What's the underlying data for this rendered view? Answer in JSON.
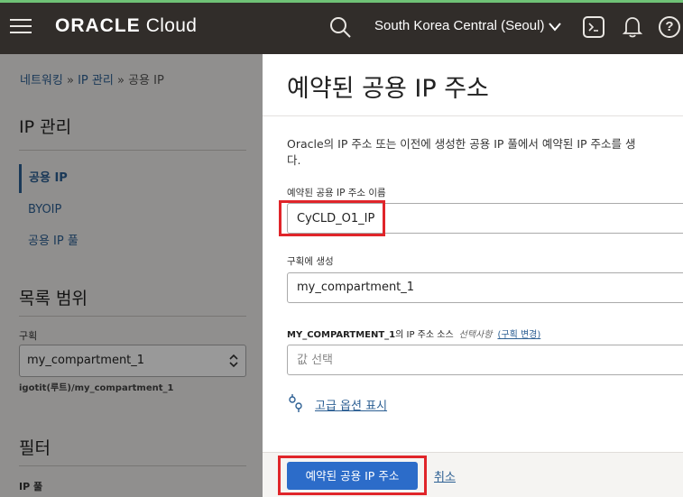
{
  "header": {
    "brand_bold": "ORACLE",
    "brand_light": " Cloud",
    "region": "South Korea Central (Seoul)",
    "help": "?"
  },
  "sidebar": {
    "breadcrumb": [
      "네트워킹",
      "IP 관리",
      "공용 IP"
    ],
    "breadcrumb_sep": "»",
    "section_title": "IP 관리",
    "nav": [
      {
        "label": "공용 IP",
        "active": true
      },
      {
        "label": "BYOIP",
        "active": false
      },
      {
        "label": "공용 IP 풀",
        "active": false
      }
    ],
    "scope_title": "목록 범위",
    "compartment_label": "구획",
    "compartment_value": "my_compartment_1",
    "compartment_path": "igotit(루트)/my_compartment_1",
    "filter_title": "필터",
    "ip_pool_label": "IP 풀"
  },
  "main": {
    "title": "예약된 공용 IP 주소",
    "description_line1": "Oracle의 IP 주소 또는 이전에 생성한 공용 IP 풀에서 예약된 IP 주소를 생",
    "description_line2": "다.",
    "name_label": "예약된 공용 IP 주소 이름",
    "name_value": "CyCLD_O1_IP",
    "compartment_label": "구획에 생성",
    "compartment_value": "my_compartment_1",
    "source_label_bold": "MY_COMPARTMENT_1",
    "source_label_rest": "의 IP 주소 소스",
    "source_optional": "선택사항",
    "source_change_link": "(구획 변경)",
    "source_placeholder": "값 선택",
    "advanced_link": "고급 옵션 표시",
    "submit_button": "예약된 공용 IP 주소",
    "cancel_link": "취소"
  },
  "colors": {
    "topbar": "#312d2a",
    "link": "#2c5f93",
    "primary": "#2c6cc9",
    "highlight": "#e0252a"
  }
}
